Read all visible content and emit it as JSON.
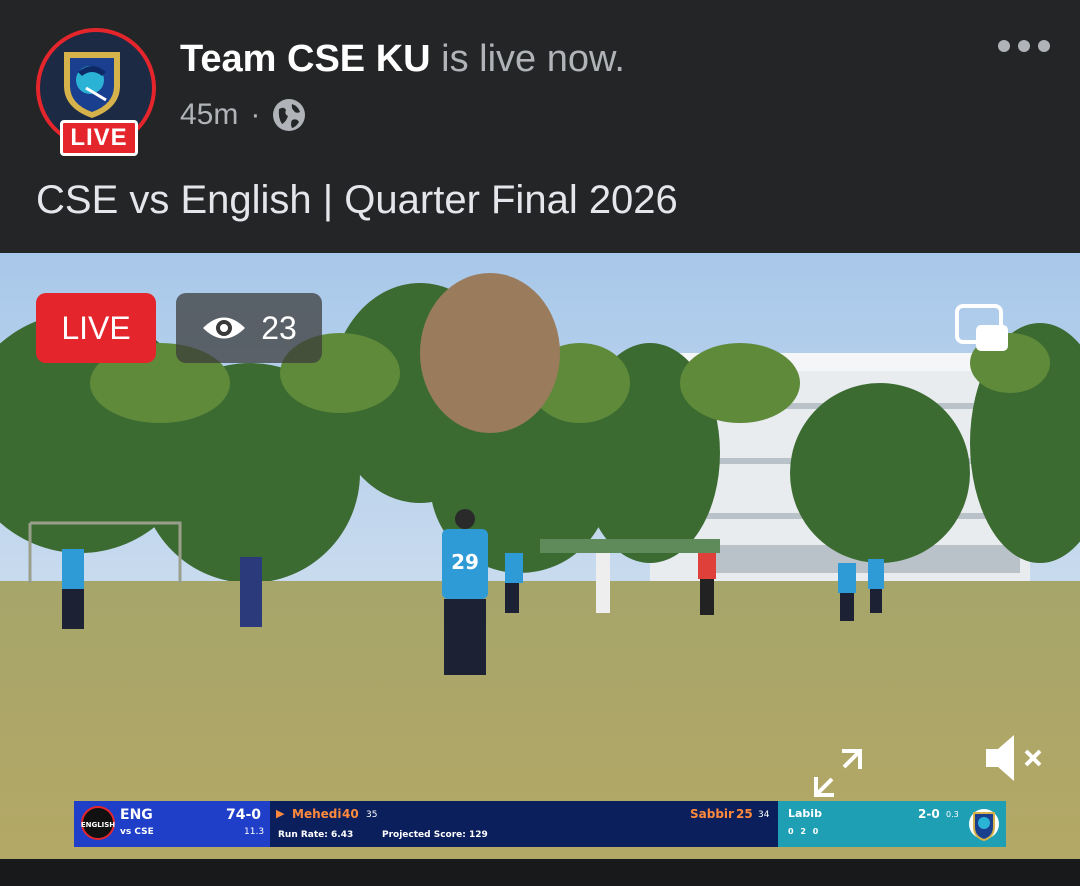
{
  "post": {
    "page_name": "Team CSE KU",
    "status_text": "is live now.",
    "time": "45m",
    "separator": "·",
    "caption": "CSE vs English | Quarter Final 2026",
    "avatar_live_label": "LIVE"
  },
  "video": {
    "live_label": "LIVE",
    "viewer_count": "23",
    "player_number": "29"
  },
  "scoreboard": {
    "team": "ENG",
    "versus": "vs CSE",
    "score": "74-0",
    "overs": "11.3",
    "logo_text": "ENGLISH",
    "batter1_name": "Mehedi",
    "batter1_runs": "40",
    "batter1_balls": "35",
    "batter2_name": "Sabbir",
    "batter2_runs": "25",
    "batter2_balls": "34",
    "run_rate_label": "Run Rate: 6.43",
    "projected_label": "Projected Score: 129",
    "bowler_name": "Labib",
    "bowler_figures": "2-0",
    "bowler_overs": "0.3",
    "over_balls": "0 2 0"
  },
  "colors": {
    "live_red": "#e4262c",
    "background": "#242526",
    "score_blue": "#1f3fc9",
    "score_navy": "#0b1f5c",
    "score_teal": "#1f9fb3",
    "batter_orange": "#ff8a3d"
  },
  "icons": {
    "globe": "globe-icon",
    "more": "more-options-icon",
    "eye": "eye-icon",
    "pip": "picture-in-picture-icon",
    "expand": "expand-icon",
    "mute": "volume-muted-icon"
  }
}
